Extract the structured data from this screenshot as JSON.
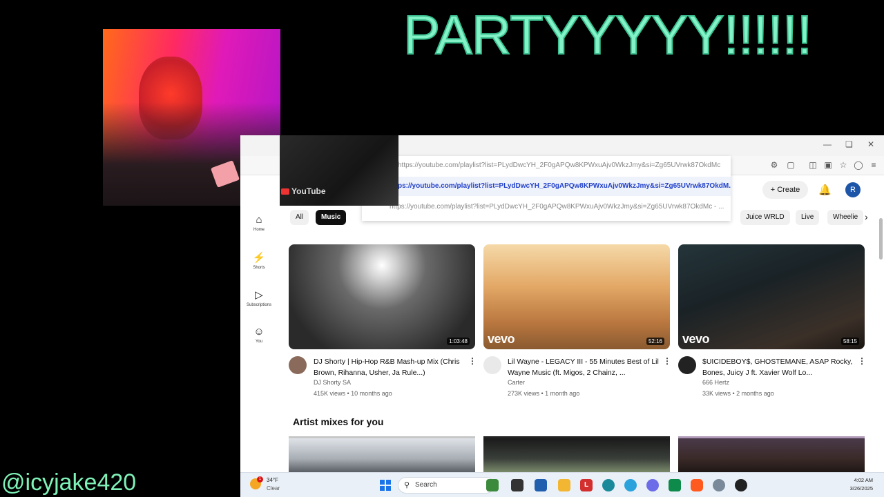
{
  "overlay": {
    "title": "PARTYYYYY!!!!!!",
    "handle": "@icyjake420",
    "title_color": "#83f3c7"
  },
  "screen_preview": {
    "mini_logo_text": "YouTube"
  },
  "browser": {
    "url_suggestions": [
      "https://youtube.com/playlist?list=PLydDwcYH_2F0gAPQw8KPWxuAjv0WkzJmy&si=Zg65UVrwk87OkdMc",
      "ps://youtube.com/playlist?list=PLydDwcYH_2F0gAPQw8KPWxuAjv0WkzJmy&si=Zg65UVrwk87OkdM...",
      "https://youtube.com/playlist?list=PLydDwcYH_2F0gAPQw8KPWxuAjv0WkzJmy&si=Zg65UVrwk87OkdMc - ..."
    ]
  },
  "youtube": {
    "header": {
      "create_label": "Create",
      "avatar_letter": "R"
    },
    "sidebar": [
      {
        "label": "Home",
        "icon": "home-icon"
      },
      {
        "label": "Shorts",
        "icon": "shorts-icon"
      },
      {
        "label": "Subscriptions",
        "icon": "subscriptions-icon"
      },
      {
        "label": "You",
        "icon": "you-icon"
      }
    ],
    "chips": [
      "All",
      "Music",
      "Juice WRLD",
      "Live",
      "Wheelie"
    ],
    "videos": [
      {
        "title": "DJ Shorty | Hip-Hop R&B Mash-up Mix (Chris Brown, Rihanna, Usher, Ja Rule...)",
        "channel": "DJ Shorty SA",
        "meta": "415K views • 10 months ago",
        "duration": "1:03:48",
        "vevo": ""
      },
      {
        "title": "Lil Wayne - LEGACY III - 55 Minutes Best of Lil Wayne Music (ft. Migos, 2 Chainz, ...",
        "channel": "Carter",
        "meta": "273K views • 1 month ago",
        "duration": "52:16",
        "vevo": "vevo"
      },
      {
        "title": "$UICIDEBOY$, GHOSTEMANE, ASAP Rocky, Bones, Juicy J ft. Xavier Wolf Lo...",
        "channel": "666 Hertz",
        "meta": "33K views • 2 months ago",
        "duration": "58:15",
        "vevo": "vevo"
      }
    ],
    "section_title": "Artist mixes for you"
  },
  "taskbar": {
    "weather_temp": "34°F",
    "weather_desc": "Clear",
    "weather_badge": "1",
    "search_label": "Search",
    "time": "4:02 AM",
    "date": "3/26/2025"
  }
}
